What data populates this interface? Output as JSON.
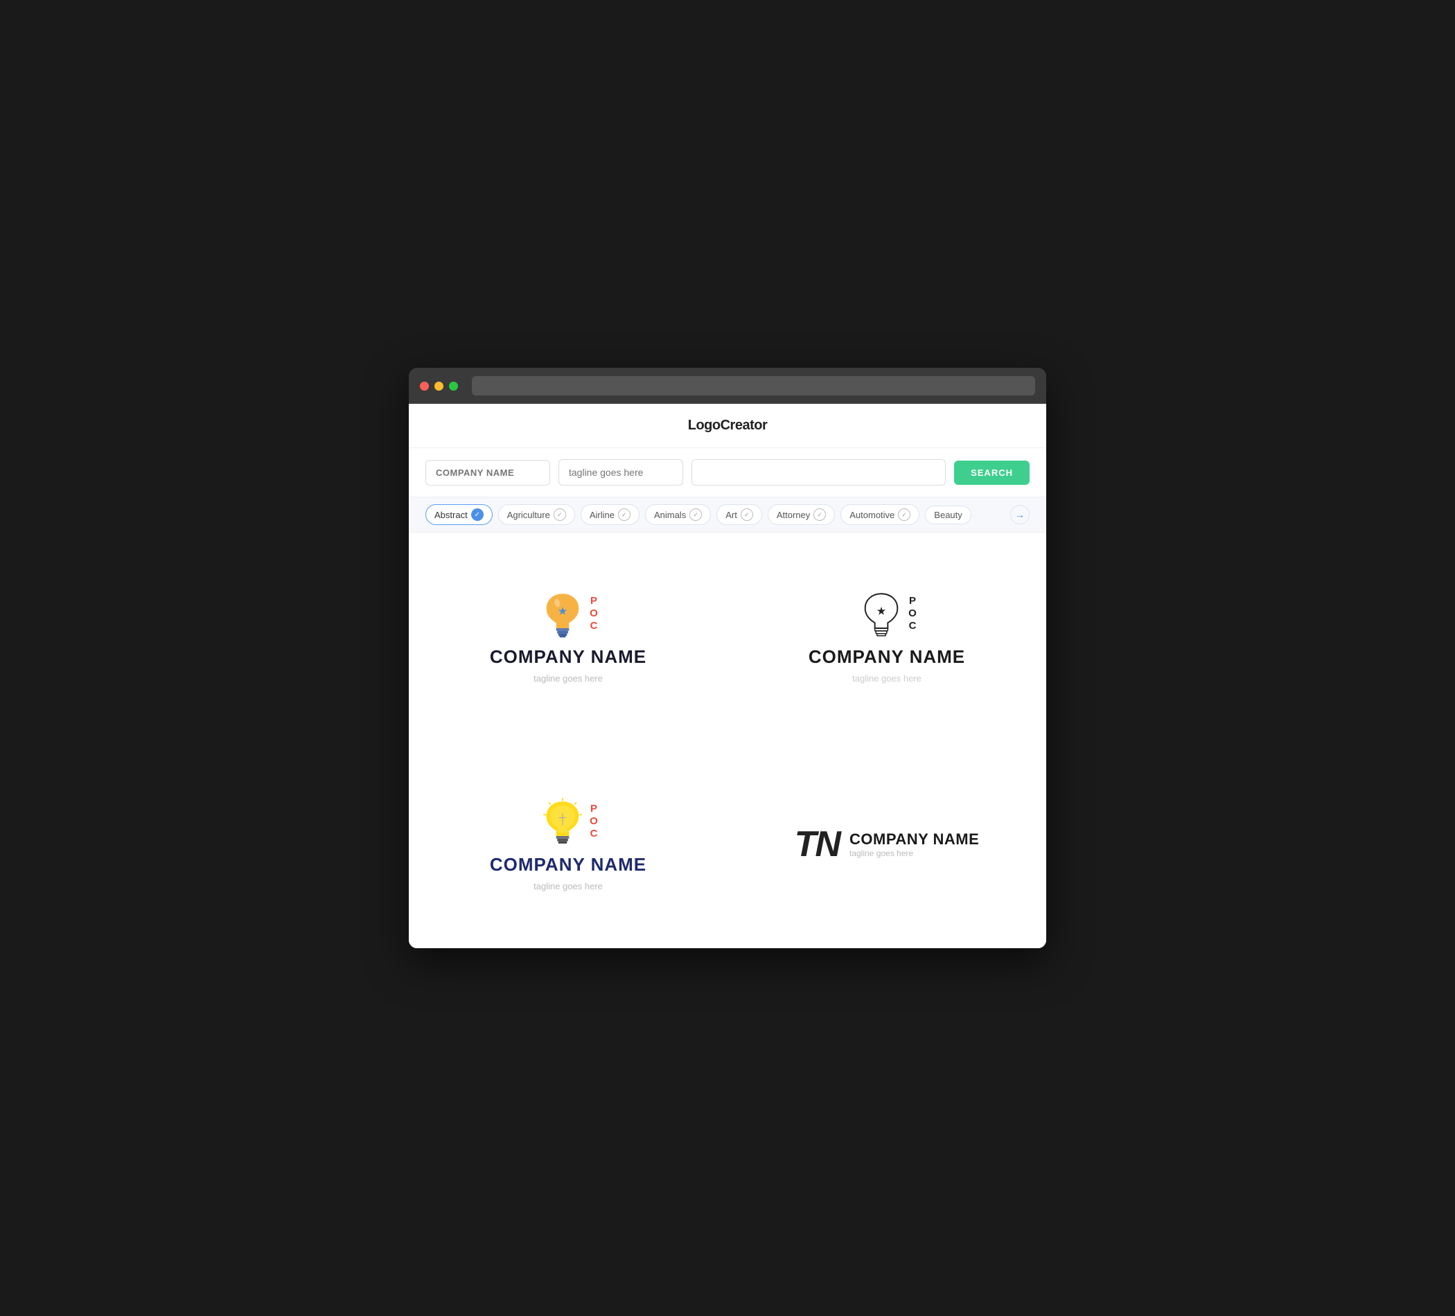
{
  "app": {
    "title": "LogoCreator"
  },
  "search": {
    "company_placeholder": "COMPANY NAME",
    "tagline_placeholder": "tagline goes here",
    "keyword_placeholder": "",
    "search_button_label": "SEARCH"
  },
  "categories": [
    {
      "id": "abstract",
      "label": "Abstract",
      "active": true
    },
    {
      "id": "agriculture",
      "label": "Agriculture",
      "active": false
    },
    {
      "id": "airline",
      "label": "Airline",
      "active": false
    },
    {
      "id": "animals",
      "label": "Animals",
      "active": false
    },
    {
      "id": "art",
      "label": "Art",
      "active": false
    },
    {
      "id": "attorney",
      "label": "Attorney",
      "active": false
    },
    {
      "id": "automotive",
      "label": "Automotive",
      "active": false
    },
    {
      "id": "beauty",
      "label": "Beauty",
      "active": false
    }
  ],
  "logos": [
    {
      "id": "logo1",
      "type": "bulb-colored",
      "company": "COMPANY NAME",
      "tagline": "tagline goes here",
      "poc_color": "red"
    },
    {
      "id": "logo2",
      "type": "bulb-outline",
      "company": "COMPANY NAME",
      "tagline": "tagline goes here",
      "poc_color": "dark"
    },
    {
      "id": "logo3",
      "type": "bulb-yellow",
      "company": "COMPANY NAME",
      "tagline": "tagline goes here",
      "poc_color": "red"
    },
    {
      "id": "logo4",
      "type": "tn-monogram",
      "company": "COMPANY NAME",
      "tagline": "tagline goes here",
      "monogram": "TN"
    }
  ],
  "icons": {
    "checkmark": "✓",
    "arrow_right": "→"
  }
}
